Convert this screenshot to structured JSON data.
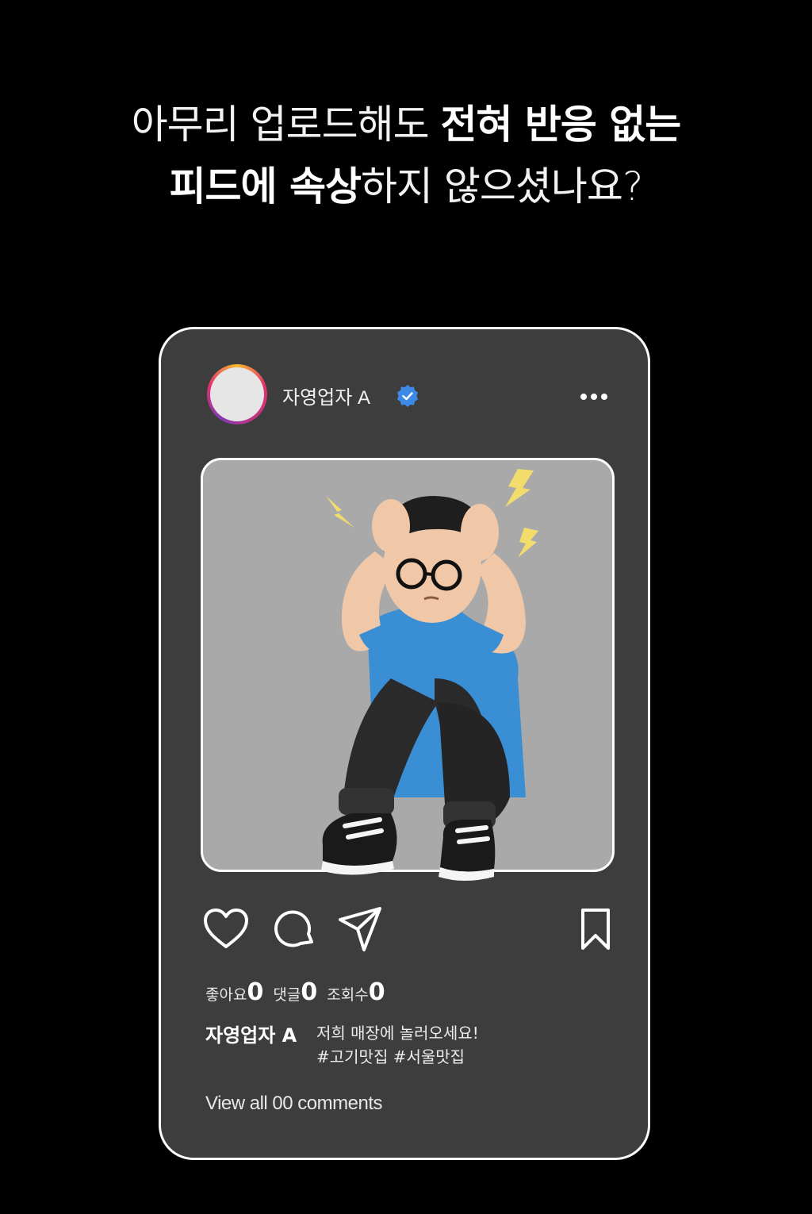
{
  "headline": {
    "line1": [
      {
        "text": "아무리 업로드해도 ",
        "weight": "light"
      },
      {
        "text": "전혀 반응 없는",
        "weight": "bold"
      }
    ],
    "line2": [
      {
        "text": "피드에 속상",
        "weight": "bold"
      },
      {
        "text": "하지 않으셨나요?",
        "weight": "light"
      }
    ]
  },
  "post": {
    "username": "자영업자 A",
    "verified_icon": "verified-badge-icon",
    "more_icon": "more-dots-icon",
    "photo_icon": "stressed-man-illustration",
    "actions": {
      "like_icon": "heart-icon",
      "comment_icon": "comment-bubble-icon",
      "share_icon": "send-paper-plane-icon",
      "save_icon": "bookmark-icon"
    },
    "stats": {
      "likes_label": "좋아요",
      "likes_count": "0",
      "comments_label": "댓글",
      "comments_count": "0",
      "views_label": "조회수",
      "views_count": "0"
    },
    "caption": {
      "author": "자영업자 A",
      "line1": "저희 매장에 놀러오세요!",
      "line2": "#고기맛집 #서울맛집"
    },
    "view_comments": "View all 00 comments"
  },
  "colors": {
    "background": "#000000",
    "card": "#3d3d3d",
    "photo_bg": "#a9a9a9",
    "verified": "#3d8ae6",
    "lightning": "#f2dc6b"
  }
}
